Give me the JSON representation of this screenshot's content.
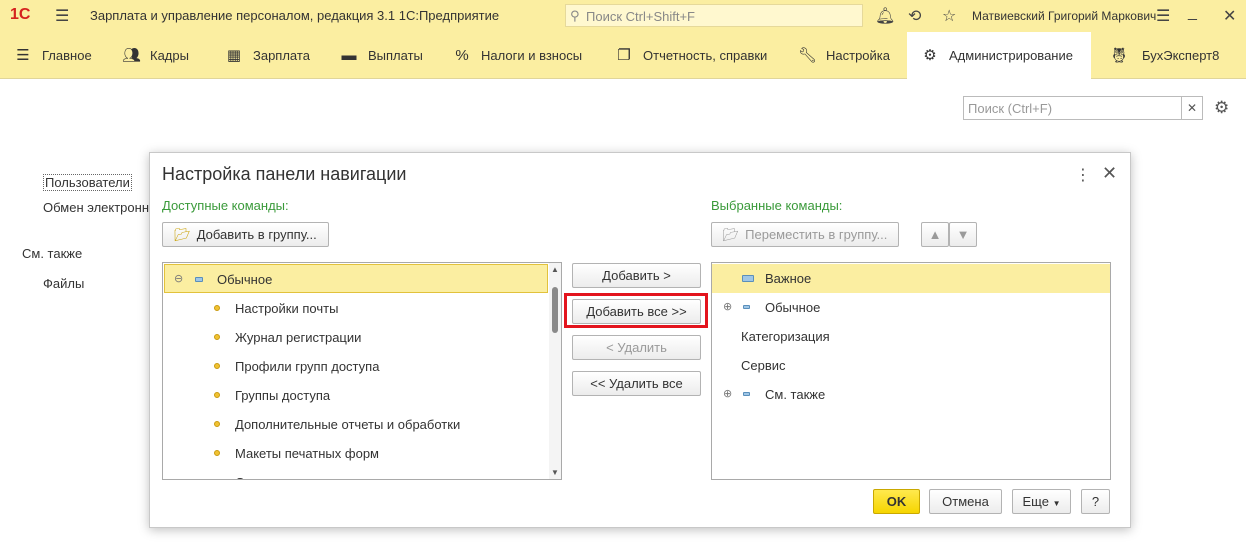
{
  "titlebar": {
    "logo": "1С",
    "app_title": "Зарплата и управление персоналом, редакция 3.1 1С:Предприятие",
    "search_placeholder": "Поиск Ctrl+Shift+F",
    "user": "Матвиевский Григорий Маркович"
  },
  "sections": [
    {
      "label": "Главное",
      "icon": "menu-icon"
    },
    {
      "label": "Кадры",
      "icon": "people-icon"
    },
    {
      "label": "Зарплата",
      "icon": "calculator-icon"
    },
    {
      "label": "Выплаты",
      "icon": "wallet-icon"
    },
    {
      "label": "Налоги и взносы",
      "icon": "percent-icon"
    },
    {
      "label": "Отчетность, справки",
      "icon": "documents-icon"
    },
    {
      "label": "Настройка",
      "icon": "wrench-icon"
    },
    {
      "label": "Администрирование",
      "icon": "gear-icon",
      "active": true
    },
    {
      "label": "БухЭксперт8",
      "icon": "owl-icon"
    }
  ],
  "page": {
    "search_placeholder": "Поиск (Ctrl+F)",
    "links": [
      "Пользователи",
      "Обмен электронны"
    ],
    "see_also_title": "См. также",
    "see_also_links": [
      "Файлы"
    ]
  },
  "dialog": {
    "title": "Настройка панели навигации",
    "available_label": "Доступные команды:",
    "selected_label": "Выбранные команды:",
    "add_to_group": "Добавить в группу...",
    "move_to_group": "Переместить в группу...",
    "add": "Добавить >",
    "add_all": "Добавить все >>",
    "remove": "< Удалить",
    "remove_all": "<< Удалить все",
    "ok": "OK",
    "cancel": "Отмена",
    "more": "Еще",
    "help": "?",
    "available_group": "Обычное",
    "available_items": [
      "Настройки почты",
      "Журнал регистрации",
      "Профили групп доступа",
      "Группы доступа",
      "Дополнительные отчеты и обработки",
      "Макеты печатных форм",
      "Отчеты"
    ],
    "selected_items": [
      "Важное",
      "Обычное",
      "Категоризация",
      "Сервис",
      "См. также"
    ]
  },
  "colors": {
    "accent": "#fbeea1",
    "highlight": "#e3141d",
    "group_label": "#3a9a3a"
  }
}
